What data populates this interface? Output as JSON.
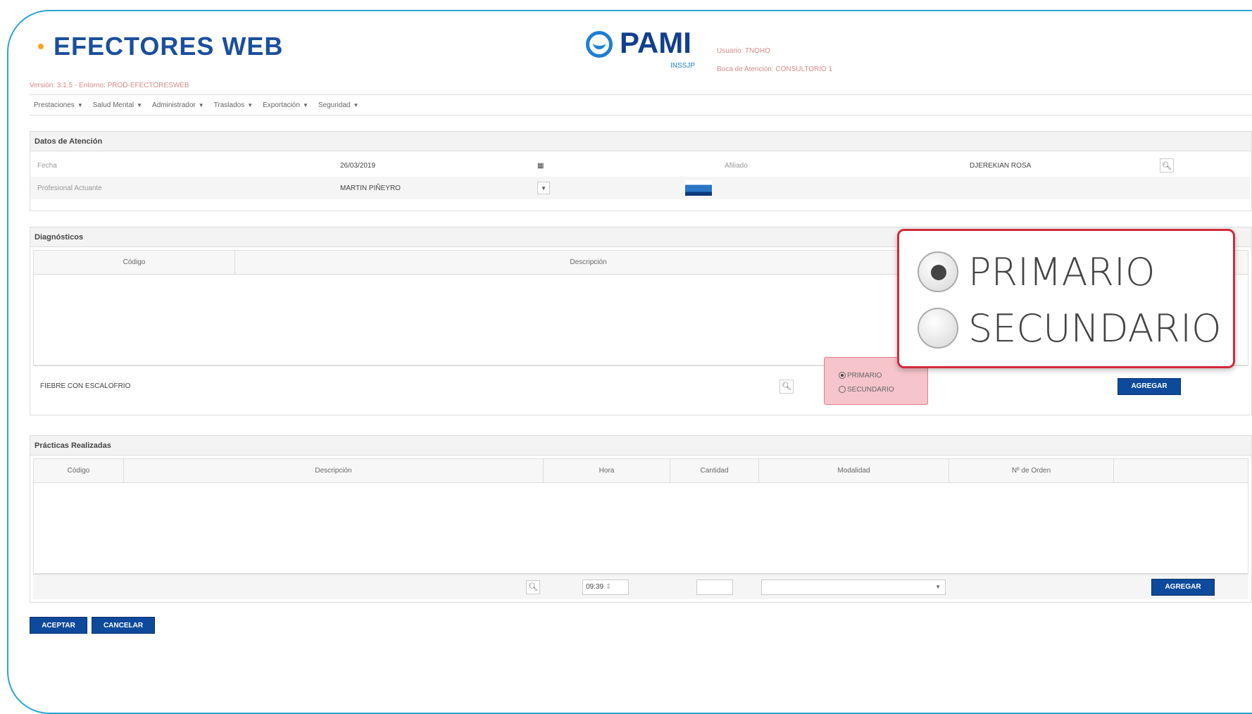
{
  "header": {
    "app_title": "EFECTORES WEB",
    "version": "Versión: 3.1.5 - Entorno: PROD-EFECTORESWEB",
    "brand": "PAMI",
    "brand_sub": "INSSJP",
    "user_label": "Usuario: TNOHO",
    "boca_label": "Boca de Atención: CONSULTORIO 1"
  },
  "menu": [
    {
      "label": "Prestaciones"
    },
    {
      "label": "Salud Mental"
    },
    {
      "label": "Administrador"
    },
    {
      "label": "Traslados"
    },
    {
      "label": "Exportación"
    },
    {
      "label": "Seguridad"
    }
  ],
  "datos": {
    "title": "Datos de Atención",
    "fecha_label": "Fecha",
    "fecha_value": "26/03/2019",
    "afiliado_label": "Afiliado",
    "afiliado_value": "DJEREKIAN ROSA",
    "profesional_label": "Profesional Actuante",
    "profesional_value": "MARTIN PIÑEYRO"
  },
  "diagnosticos": {
    "title": "Diagnósticos",
    "col_codigo": "Código",
    "col_descripcion": "Descripción",
    "input_value": "FIEBRE CON ESCALOFRIO",
    "radio_primario": "PRIMARIO",
    "radio_secundario": "SECUNDARIO",
    "add_button": "AGREGAR"
  },
  "zoom": {
    "primario": "PRIMARIO",
    "secundario": "SECUNDARIO"
  },
  "practicas": {
    "title": "Prácticas Realizadas",
    "columns": [
      "Código",
      "Descripción",
      "Hora",
      "Cantidad",
      "Modalidad",
      "Nº de Orden"
    ],
    "hora_value": "09:39",
    "add_button": "AGREGAR"
  },
  "footer": {
    "accept": "ACEPTAR",
    "cancel": "CANCELAR"
  },
  "colors": {
    "accent": "#0e4a9b",
    "highlight_border": "#d02b3b",
    "frame": "#2aa5d8"
  }
}
